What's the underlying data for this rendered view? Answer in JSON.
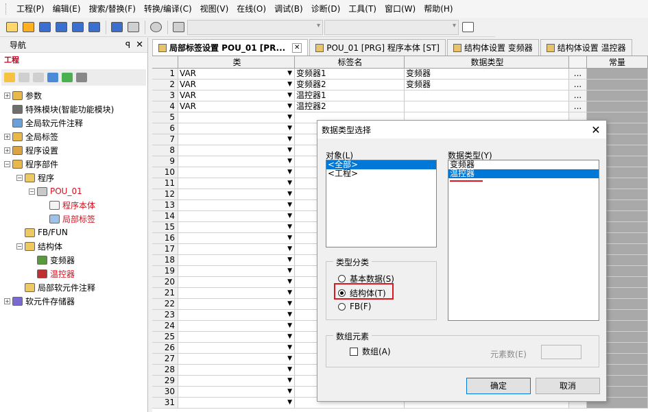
{
  "menu": [
    "工程(P)",
    "编辑(E)",
    "搜索/替换(F)",
    "转换/编译(C)",
    "视图(V)",
    "在线(O)",
    "调试(B)",
    "诊断(D)",
    "工具(T)",
    "窗口(W)",
    "帮助(H)"
  ],
  "nav": {
    "title": "导航",
    "pin_glyph": "ꟼ",
    "close_glyph": "✕",
    "section": "工程",
    "items": [
      {
        "label": "参数",
        "level": 0,
        "exp": "+",
        "red": false
      },
      {
        "label": "特殊模块(智能功能模块)",
        "level": 0,
        "exp": "",
        "red": false
      },
      {
        "label": "全局软元件注释",
        "level": 0,
        "exp": "",
        "red": false
      },
      {
        "label": "全局标签",
        "level": 0,
        "exp": "+",
        "red": false
      },
      {
        "label": "程序设置",
        "level": 0,
        "exp": "+",
        "red": false
      },
      {
        "label": "程序部件",
        "level": 0,
        "exp": "−",
        "red": false
      },
      {
        "label": "程序",
        "level": 1,
        "exp": "−",
        "red": false
      },
      {
        "label": "POU_01",
        "level": 2,
        "exp": "−",
        "red": true
      },
      {
        "label": "程序本体",
        "level": 3,
        "exp": "",
        "red": true
      },
      {
        "label": "局部标签",
        "level": 3,
        "exp": "",
        "red": true
      },
      {
        "label": "FB/FUN",
        "level": 1,
        "exp": "",
        "red": false
      },
      {
        "label": "结构体",
        "level": 1,
        "exp": "−",
        "red": false
      },
      {
        "label": "变频器",
        "level": 2,
        "exp": "",
        "red": false
      },
      {
        "label": "温控器",
        "level": 2,
        "exp": "",
        "red": true
      },
      {
        "label": "局部软元件注释",
        "level": 1,
        "exp": "",
        "red": false
      },
      {
        "label": "软元件存储器",
        "level": 0,
        "exp": "+",
        "red": false
      }
    ]
  },
  "tabs": [
    {
      "label": "局部标签设置 POU_01 [PR...",
      "active": true,
      "close": "✕"
    },
    {
      "label": "POU_01 [PRG] 程序本体 [ST]",
      "active": false,
      "close": ""
    },
    {
      "label": "结构体设置 变频器",
      "active": false,
      "close": ""
    },
    {
      "label": "结构体设置 温控器",
      "active": false,
      "close": ""
    }
  ],
  "grid": {
    "headers": [
      "",
      "类",
      "标签名",
      "数据类型",
      "",
      "常量"
    ],
    "rows": [
      {
        "num": "1",
        "cls": "VAR",
        "name": "变频器1",
        "type": "变频器",
        "btn": "..."
      },
      {
        "num": "2",
        "cls": "VAR",
        "name": "变频器2",
        "type": "变频器",
        "btn": "..."
      },
      {
        "num": "3",
        "cls": "VAR",
        "name": "温控器1",
        "type": "",
        "btn": "..."
      },
      {
        "num": "4",
        "cls": "VAR",
        "name": "温控器2",
        "type": "",
        "btn": "..."
      },
      {
        "num": "5",
        "cls": "",
        "name": "",
        "type": "",
        "btn": ""
      },
      {
        "num": "6",
        "cls": "",
        "name": "",
        "type": "",
        "btn": ""
      },
      {
        "num": "7",
        "cls": "",
        "name": "",
        "type": "",
        "btn": ""
      },
      {
        "num": "8",
        "cls": "",
        "name": "",
        "type": "",
        "btn": ""
      },
      {
        "num": "9",
        "cls": "",
        "name": "",
        "type": "",
        "btn": ""
      },
      {
        "num": "10",
        "cls": "",
        "name": "",
        "type": "",
        "btn": ""
      },
      {
        "num": "11",
        "cls": "",
        "name": "",
        "type": "",
        "btn": ""
      },
      {
        "num": "12",
        "cls": "",
        "name": "",
        "type": "",
        "btn": ""
      },
      {
        "num": "13",
        "cls": "",
        "name": "",
        "type": "",
        "btn": ""
      },
      {
        "num": "14",
        "cls": "",
        "name": "",
        "type": "",
        "btn": ""
      },
      {
        "num": "15",
        "cls": "",
        "name": "",
        "type": "",
        "btn": ""
      },
      {
        "num": "16",
        "cls": "",
        "name": "",
        "type": "",
        "btn": ""
      },
      {
        "num": "17",
        "cls": "",
        "name": "",
        "type": "",
        "btn": ""
      },
      {
        "num": "18",
        "cls": "",
        "name": "",
        "type": "",
        "btn": ""
      },
      {
        "num": "19",
        "cls": "",
        "name": "",
        "type": "",
        "btn": ""
      },
      {
        "num": "20",
        "cls": "",
        "name": "",
        "type": "",
        "btn": ""
      },
      {
        "num": "21",
        "cls": "",
        "name": "",
        "type": "",
        "btn": ""
      },
      {
        "num": "22",
        "cls": "",
        "name": "",
        "type": "",
        "btn": ""
      },
      {
        "num": "23",
        "cls": "",
        "name": "",
        "type": "",
        "btn": ""
      },
      {
        "num": "24",
        "cls": "",
        "name": "",
        "type": "",
        "btn": ""
      },
      {
        "num": "25",
        "cls": "",
        "name": "",
        "type": "",
        "btn": ""
      },
      {
        "num": "26",
        "cls": "",
        "name": "",
        "type": "",
        "btn": ""
      },
      {
        "num": "27",
        "cls": "",
        "name": "",
        "type": "",
        "btn": ""
      },
      {
        "num": "28",
        "cls": "",
        "name": "",
        "type": "",
        "btn": ""
      },
      {
        "num": "29",
        "cls": "",
        "name": "",
        "type": "",
        "btn": ""
      },
      {
        "num": "30",
        "cls": "",
        "name": "",
        "type": "",
        "btn": ""
      },
      {
        "num": "31",
        "cls": "",
        "name": "",
        "type": "",
        "btn": ""
      }
    ]
  },
  "dialog": {
    "title": "数据类型选择",
    "close_glyph": "✕",
    "object_label": "对象(L)",
    "object_items": [
      "<全部>",
      "<工程>"
    ],
    "datatype_label": "数据类型(Y)",
    "datatype_items": [
      "变频器",
      "温控器"
    ],
    "category_label": "类型分类",
    "radio_basic": "基本数据(S)",
    "radio_struct": "结构体(T)",
    "radio_fb": "FB(F)",
    "array_label": "数组元素",
    "array_checkbox": "数组(A)",
    "element_count_label": "元素数(E)",
    "ok": "确定",
    "cancel": "取消"
  },
  "colors": {
    "accent": "#0078d7",
    "highlight": "#e0141e",
    "tree_red": "#d0101e"
  }
}
